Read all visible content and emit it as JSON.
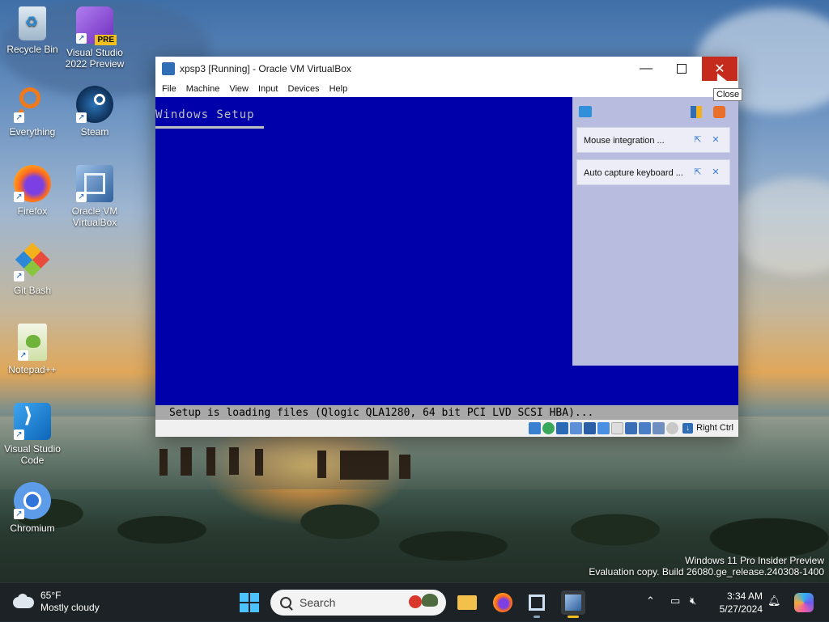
{
  "desktop": {
    "icons": [
      {
        "label": "Recycle Bin",
        "icon": "recycle-bin-icon"
      },
      {
        "label": "Visual Studio 2022 Preview",
        "icon": "visual-studio-preview-icon",
        "badge": "PRE"
      },
      {
        "label": "Everything",
        "icon": "everything-search-icon"
      },
      {
        "label": "Steam",
        "icon": "steam-icon"
      },
      {
        "label": "Firefox",
        "icon": "firefox-icon"
      },
      {
        "label": "Oracle VM VirtualBox",
        "icon": "virtualbox-icon"
      },
      {
        "label": "Git Bash",
        "icon": "git-bash-icon"
      },
      {
        "label": "Notepad++",
        "icon": "notepad-plus-plus-icon"
      },
      {
        "label": "Visual Studio Code",
        "icon": "vscode-icon"
      },
      {
        "label": "Chromium",
        "icon": "chromium-icon"
      }
    ],
    "watermark": {
      "line1": "Windows 11 Pro Insider Preview",
      "line2": "Evaluation copy. Build 26080.ge_release.240308-1400"
    }
  },
  "vbox_window": {
    "title": "xpsp3 [Running] - Oracle VM VirtualBox",
    "menu": [
      "File",
      "Machine",
      "View",
      "Input",
      "Devices",
      "Help"
    ],
    "tooltip": "Close",
    "guest": {
      "setup_title": "Windows Setup",
      "status_line": "Setup is loading files (Qlogic QLA1280, 64 bit PCI LVD SCSI HBA)..."
    },
    "notifications": [
      {
        "label": "Mouse integration ..."
      },
      {
        "label": "Auto capture keyboard ..."
      }
    ],
    "host_key": "Right Ctrl"
  },
  "taskbar": {
    "weather": {
      "temp": "65°F",
      "condition": "Mostly cloudy"
    },
    "search_placeholder": "Search",
    "time": "3:34 AM",
    "date": "5/27/2024"
  },
  "colors": {
    "guest_bg": "#0000aa",
    "close_red": "#c42b1c",
    "accent": "#4cc2ff"
  }
}
